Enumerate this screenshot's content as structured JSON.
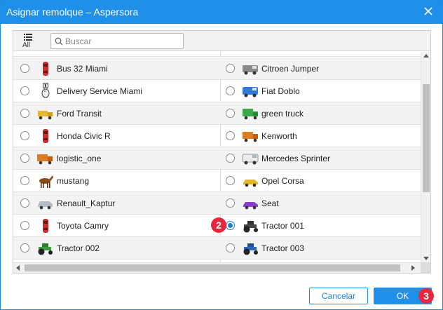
{
  "dialog": {
    "title": "Asignar remolque – Aspersora",
    "close_icon": "close-icon"
  },
  "toolbar": {
    "all_label": "All",
    "all_icon": "list-icon",
    "search_icon": "search-icon",
    "search_placeholder": "Buscar",
    "search_value": ""
  },
  "rows": [
    {
      "left": {
        "name": "Bus 32 Miami",
        "icon": "car-red-icon",
        "checked": false
      },
      "right": {
        "name": "Citroen Jumper",
        "icon": "van-gray-icon",
        "checked": false
      }
    },
    {
      "left": {
        "name": "Delivery Service Miami",
        "icon": "rabbit-icon",
        "checked": false
      },
      "right": {
        "name": "Fiat Doblo",
        "icon": "van-blue-icon",
        "checked": false
      }
    },
    {
      "left": {
        "name": "Ford Transit",
        "icon": "truck-yellow-icon",
        "checked": false
      },
      "right": {
        "name": "green truck",
        "icon": "truck-green-icon",
        "checked": false
      }
    },
    {
      "left": {
        "name": "Honda Civic R",
        "icon": "car-red-icon",
        "checked": false
      },
      "right": {
        "name": "Kenworth",
        "icon": "truck-orange-icon",
        "checked": false
      }
    },
    {
      "left": {
        "name": "logistic_one",
        "icon": "truck-orange-icon",
        "checked": false
      },
      "right": {
        "name": "Mercedes Sprinter",
        "icon": "van-white-icon",
        "checked": false
      }
    },
    {
      "left": {
        "name": "mustang",
        "icon": "horse-icon",
        "checked": false
      },
      "right": {
        "name": "Opel Corsa",
        "icon": "car-yellow-icon",
        "checked": false
      }
    },
    {
      "left": {
        "name": "Renault_Kaptur",
        "icon": "car-silver-icon",
        "checked": false
      },
      "right": {
        "name": "Seat",
        "icon": "car-purple-icon",
        "checked": false
      }
    },
    {
      "left": {
        "name": "Toyota Camry",
        "icon": "car-red-icon",
        "checked": false
      },
      "right": {
        "name": "Tractor 001",
        "icon": "tractor-dark-icon",
        "checked": true
      }
    },
    {
      "left": {
        "name": "Tractor 002",
        "icon": "tractor-green-icon",
        "checked": false
      },
      "right": {
        "name": "Tractor 003",
        "icon": "tractor-blue-icon",
        "checked": false
      }
    }
  ],
  "buttons": {
    "cancel": "Cancelar",
    "ok": "OK"
  },
  "markers": {
    "step_radio": "2",
    "step_ok": "3"
  },
  "colors": {
    "accent": "#1e90ea",
    "marker": "#e8263d",
    "row_alt": "#f3f3f3"
  }
}
